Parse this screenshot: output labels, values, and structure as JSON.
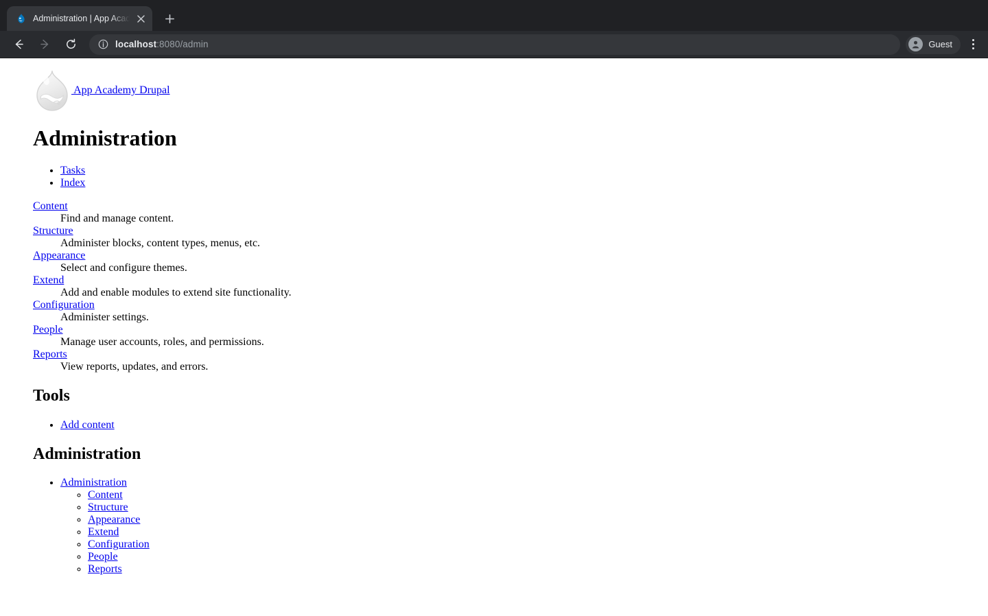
{
  "browser": {
    "tab": {
      "title": "Administration | App Academy Drupal",
      "favicon_name": "drupal-droplet-favicon",
      "close_label": "×"
    },
    "new_tab_label": "+",
    "nav": {
      "back_label": "←",
      "forward_label": "→",
      "reload_label": "↻"
    },
    "omnibox": {
      "info_icon": "site-information-icon",
      "host": "localhost",
      "path": ":8080/admin",
      "full_url": "localhost:8080/admin"
    },
    "profile": {
      "name": "Guest",
      "avatar_icon": "person-avatar-icon"
    },
    "menu_label": "⋮",
    "colors": {
      "tabstrip_bg": "#202124",
      "toolbar_bg": "#292b2f",
      "active_tab_bg": "#35373b",
      "omnibox_bg": "#35373b",
      "text_primary": "#e8eaed",
      "text_secondary": "#9aa0a6"
    }
  },
  "page": {
    "branding": {
      "logo_name": "drupal-droplet-logo",
      "site_name": " App Academy Drupal"
    },
    "title": "Administration",
    "local_tasks": [
      {
        "label": "Tasks"
      },
      {
        "label": "Index"
      }
    ],
    "admin_blocks": [
      {
        "term": "Content",
        "description": "Find and manage content."
      },
      {
        "term": "Structure",
        "description": "Administer blocks, content types, menus, etc."
      },
      {
        "term": "Appearance",
        "description": "Select and configure themes."
      },
      {
        "term": "Extend",
        "description": "Add and enable modules to extend site functionality."
      },
      {
        "term": "Configuration",
        "description": "Administer settings."
      },
      {
        "term": "People",
        "description": "Manage user accounts, roles, and permissions."
      },
      {
        "term": "Reports",
        "description": "View reports, updates, and errors."
      }
    ],
    "tools": {
      "heading": "Tools",
      "items": [
        {
          "label": "Add content"
        }
      ]
    },
    "administration_menu": {
      "heading": "Administration",
      "root": {
        "label": "Administration"
      },
      "children": [
        {
          "label": "Content"
        },
        {
          "label": "Structure"
        },
        {
          "label": "Appearance"
        },
        {
          "label": "Extend"
        },
        {
          "label": "Configuration"
        },
        {
          "label": "People"
        },
        {
          "label": "Reports"
        }
      ]
    },
    "colors": {
      "link": "#0000ee",
      "text": "#000000",
      "background": "#ffffff"
    }
  }
}
